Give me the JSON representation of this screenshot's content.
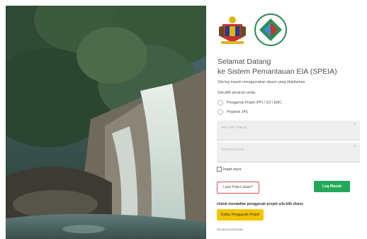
{
  "hero": {
    "image": "waterfall-forest-photo"
  },
  "panel": {
    "logos": [
      "government-crest-logo",
      "department-environment-logo"
    ],
    "welcome": {
      "line1": "Selamat Datang",
      "line2": "ke Sistem Pemantauan EIA (SPEIA)"
    },
    "description": "Sila log masuk menggunakan akaun yang didaftarkan.",
    "role_label": "Sila pilih peranan anda.",
    "roles": [
      {
        "label": "Penggerak Projek (PP) / SO / EMC"
      },
      {
        "label": "Pegawai JAS"
      }
    ],
    "fields": {
      "id": {
        "placeholder": "NO. K/P / EMAIL",
        "required_mark": "*"
      },
      "password": {
        "placeholder": "KATA LALUAN",
        "required_mark": "*"
      }
    },
    "remember": "Ingat saya",
    "buttons": {
      "forgot": "Lupa Kata Laluan?",
      "login": "Log Masuk",
      "register": "Daftar Penggerak Projek"
    },
    "register_note": "Untuk mendaftar penggerak projek sila klik disini,",
    "links": [
      "Senarai pertanyaan"
    ],
    "colors": {
      "login_button": "#25a75a",
      "register_button": "#f2c500",
      "forgot_border": "#e05353"
    }
  }
}
